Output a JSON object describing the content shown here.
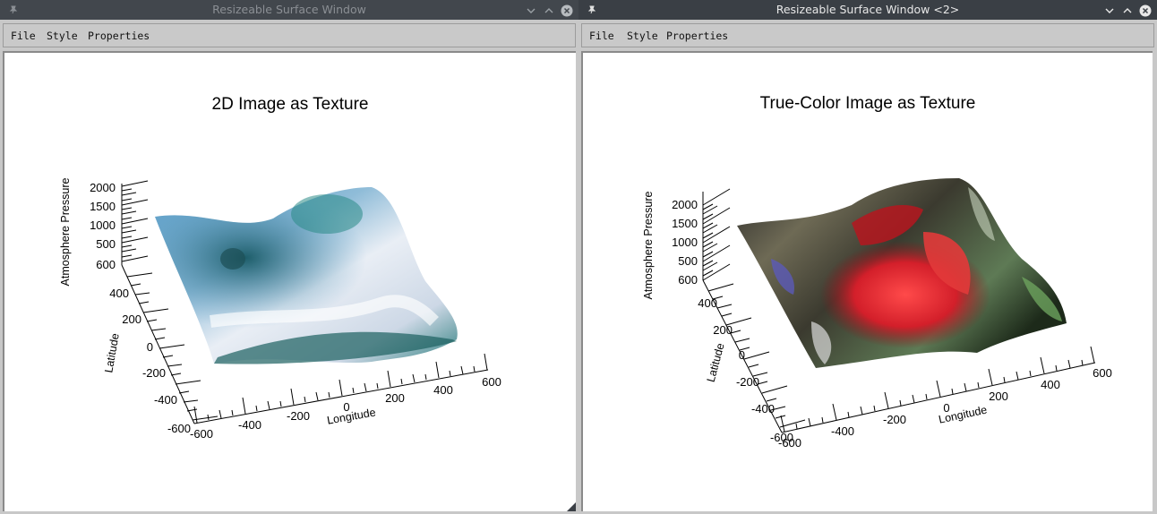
{
  "windows": [
    {
      "title": "Resizeable Surface Window",
      "menu": [
        "File",
        "Style",
        "Properties"
      ],
      "plot": {
        "title": "2D Image as Texture",
        "z_axis_label": "Atmosphere Pressure",
        "y_axis_label": "Latitude",
        "x_axis_label": "Longitude",
        "z_ticks": [
          "2000",
          "1500",
          "1000",
          "500",
          "600"
        ],
        "y_ticks": [
          "400",
          "200",
          "0",
          "-200",
          "-400",
          "-600"
        ],
        "x_ticks": [
          "-600",
          "-400",
          "-200",
          "0",
          "200",
          "400",
          "600"
        ],
        "texture": "world-map-blue"
      }
    },
    {
      "title": "Resizeable Surface Window <2>",
      "menu": [
        "File",
        "Style",
        "Properties"
      ],
      "plot": {
        "title": "True-Color Image as Texture",
        "z_axis_label": "Atmosphere Pressure",
        "y_axis_label": "Latitude",
        "x_axis_label": "Longitude",
        "z_ticks": [
          "2000",
          "1500",
          "1000",
          "500",
          "600"
        ],
        "y_ticks": [
          "400",
          "200",
          "0",
          "-200",
          "-400",
          "-600"
        ],
        "x_ticks": [
          "-600",
          "-400",
          "-200",
          "0",
          "200",
          "400",
          "600"
        ],
        "texture": "red-rose"
      }
    }
  ],
  "icons": {
    "pin": "pin-icon",
    "minimize": "chevron-down-icon",
    "maximize": "chevron-up-icon",
    "close": "close-icon"
  }
}
